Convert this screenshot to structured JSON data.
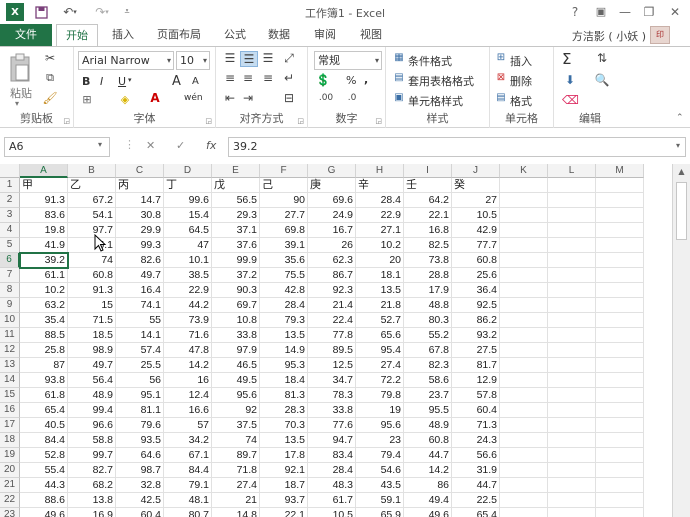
{
  "window": {
    "title": "工作簿1 - Excel",
    "help": "?",
    "minimize": "—",
    "restore": "❐",
    "close": "✕"
  },
  "tabs": [
    {
      "label": "文件"
    },
    {
      "label": "开始"
    },
    {
      "label": "插入"
    },
    {
      "label": "页面布局"
    },
    {
      "label": "公式"
    },
    {
      "label": "数据"
    },
    {
      "label": "审阅"
    },
    {
      "label": "视图"
    }
  ],
  "user": {
    "name": "方洁影 ( 小妖 )"
  },
  "ribbon": {
    "clipboard": {
      "label": "剪贴板",
      "paste": "粘贴"
    },
    "font": {
      "label": "字体",
      "family": "Arial Narrow",
      "size": "10",
      "bold": "B",
      "italic": "I",
      "underline": "U",
      "grow": "A",
      "shrink": "A",
      "phonetic": "wén"
    },
    "alignment": {
      "label": "对齐方式"
    },
    "number": {
      "label": "数字",
      "format": "常规",
      "percent": "%",
      "comma": ","
    },
    "styles": {
      "label": "样式",
      "conditional": "条件格式",
      "table": "套用表格格式",
      "cell": "单元格样式"
    },
    "cells": {
      "label": "单元格",
      "insert": "插入",
      "delete": "删除",
      "format": "格式"
    },
    "editing": {
      "label": "编辑",
      "sum": "Σ"
    }
  },
  "formula_bar": {
    "name_box": "A6",
    "cancel": "✕",
    "enter": "✓",
    "fx": "fx",
    "value": "39.2"
  },
  "sheet": {
    "columns": [
      "A",
      "B",
      "C",
      "D",
      "E",
      "F",
      "G",
      "H",
      "I",
      "J",
      "K",
      "L",
      "M"
    ],
    "row_numbers": [
      "1",
      "2",
      "3",
      "4",
      "5",
      "6",
      "7",
      "8",
      "9",
      "10",
      "11",
      "12",
      "13",
      "14",
      "15",
      "16",
      "17",
      "18",
      "19",
      "20",
      "21",
      "22",
      "23"
    ],
    "header_row": [
      "甲",
      "乙",
      "丙",
      "丁",
      "戊",
      "己",
      "庚",
      "辛",
      "壬",
      "癸"
    ],
    "rows": [
      [
        "91.3",
        "67.2",
        "14.7",
        "99.6",
        "56.5",
        "90",
        "69.6",
        "28.4",
        "64.2",
        "27"
      ],
      [
        "83.6",
        "54.1",
        "30.8",
        "15.4",
        "29.3",
        "27.7",
        "24.9",
        "22.9",
        "22.1",
        "10.5"
      ],
      [
        "19.8",
        "97.7",
        "29.9",
        "64.5",
        "37.1",
        "69.8",
        "16.7",
        "27.1",
        "16.8",
        "42.9"
      ],
      [
        "41.9",
        "5.1",
        "99.3",
        "47",
        "37.6",
        "39.1",
        "26",
        "10.2",
        "82.5",
        "77.7"
      ],
      [
        "39.2",
        "74",
        "82.6",
        "10.1",
        "99.9",
        "35.6",
        "62.3",
        "20",
        "73.8",
        "60.8"
      ],
      [
        "61.1",
        "60.8",
        "49.7",
        "38.5",
        "37.2",
        "75.5",
        "86.7",
        "18.1",
        "28.8",
        "25.6"
      ],
      [
        "10.2",
        "91.3",
        "16.4",
        "22.9",
        "90.3",
        "42.8",
        "92.3",
        "13.5",
        "17.9",
        "36.4"
      ],
      [
        "63.2",
        "15",
        "74.1",
        "44.2",
        "69.7",
        "28.4",
        "21.4",
        "21.8",
        "48.8",
        "92.5"
      ],
      [
        "35.4",
        "71.5",
        "55",
        "73.9",
        "10.8",
        "79.3",
        "22.4",
        "52.7",
        "80.3",
        "86.2"
      ],
      [
        "88.5",
        "18.5",
        "14.1",
        "71.6",
        "33.8",
        "13.5",
        "77.8",
        "65.6",
        "55.2",
        "93.2"
      ],
      [
        "25.8",
        "98.9",
        "57.4",
        "47.8",
        "97.9",
        "14.9",
        "89.5",
        "95.4",
        "67.8",
        "27.5"
      ],
      [
        "87",
        "49.7",
        "25.5",
        "14.2",
        "46.5",
        "95.3",
        "12.5",
        "27.4",
        "82.3",
        "81.7"
      ],
      [
        "93.8",
        "56.4",
        "56",
        "16",
        "49.5",
        "18.4",
        "34.7",
        "72.2",
        "58.6",
        "12.9"
      ],
      [
        "61.8",
        "48.9",
        "95.1",
        "12.4",
        "95.6",
        "81.3",
        "78.3",
        "79.8",
        "23.7",
        "57.8"
      ],
      [
        "65.4",
        "99.4",
        "81.1",
        "16.6",
        "92",
        "28.3",
        "33.8",
        "19",
        "95.5",
        "60.4"
      ],
      [
        "40.5",
        "96.6",
        "79.6",
        "57",
        "37.5",
        "70.3",
        "77.6",
        "95.6",
        "48.9",
        "71.3"
      ],
      [
        "84.4",
        "58.8",
        "93.5",
        "34.2",
        "74",
        "13.5",
        "94.7",
        "23",
        "60.8",
        "24.3"
      ],
      [
        "52.8",
        "99.7",
        "64.6",
        "67.1",
        "89.7",
        "17.8",
        "83.4",
        "79.4",
        "44.7",
        "56.6"
      ],
      [
        "55.4",
        "82.7",
        "98.7",
        "84.4",
        "71.8",
        "92.1",
        "28.4",
        "54.6",
        "14.2",
        "31.9"
      ],
      [
        "44.3",
        "68.2",
        "32.8",
        "79.1",
        "27.4",
        "18.7",
        "48.3",
        "43.5",
        "86",
        "44.7"
      ],
      [
        "88.6",
        "13.8",
        "42.5",
        "48.1",
        "21",
        "93.7",
        "61.7",
        "59.1",
        "49.4",
        "22.5"
      ],
      [
        "49.6",
        "16.9",
        "60.4",
        "80.7",
        "14.8",
        "22.1",
        "10.5",
        "65.9",
        "49.6",
        "65.4"
      ]
    ],
    "selected_cell": "A6"
  },
  "colors": {
    "accent": "#217346",
    "grid": "#e1e1e1",
    "header_bg": "#f3f3f3"
  }
}
